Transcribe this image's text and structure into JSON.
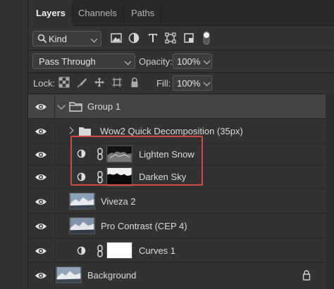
{
  "tabs": [
    {
      "label": "Layers",
      "active": true
    },
    {
      "label": "Channels",
      "active": false
    },
    {
      "label": "Paths",
      "active": false
    }
  ],
  "filter": {
    "kind_label": "Kind",
    "icons": [
      "image-filter-icon",
      "adjustment-filter-icon",
      "type-filter-icon",
      "shape-filter-icon",
      "smart-object-filter-icon",
      "filter-toggle-icon"
    ]
  },
  "blend": {
    "mode": "Pass Through",
    "opacity_label": "Opacity:",
    "opacity_value": "100%"
  },
  "lock": {
    "label": "Lock:",
    "fill_label": "Fill:",
    "fill_value": "100%",
    "icons": [
      "lock-transparent-icon",
      "lock-image-icon",
      "lock-position-icon",
      "lock-artboard-icon",
      "lock-all-icon"
    ]
  },
  "layers": [
    {
      "name": "Group 1",
      "kind": "group",
      "expanded": true
    },
    {
      "name": "Wow2 Quick Decomposition (35px)",
      "kind": "group",
      "expanded": false
    },
    {
      "name": "Lighten Snow",
      "kind": "adjustment-masked"
    },
    {
      "name": "Darken Sky",
      "kind": "adjustment-masked"
    },
    {
      "name": "Viveza 2",
      "kind": "image"
    },
    {
      "name": "Pro Contrast (CEP 4)",
      "kind": "image"
    },
    {
      "name": "Curves 1",
      "kind": "adjustment"
    },
    {
      "name": "Background",
      "kind": "background",
      "locked": true
    }
  ],
  "colors": {
    "highlight_border": "#d14a3f",
    "panel_bg": "#323232",
    "selected_row": "#444444"
  }
}
